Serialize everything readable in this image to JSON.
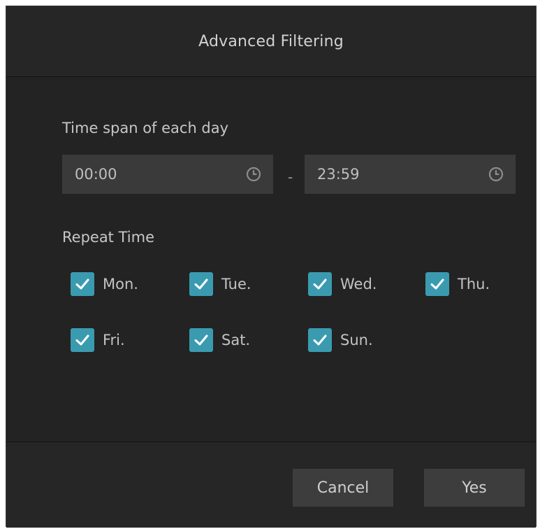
{
  "dialog": {
    "title": "Advanced Filtering"
  },
  "time_span": {
    "label": "Time span of each day",
    "start_value": "00:00",
    "separator": "-",
    "end_value": "23:59",
    "icon": "clock-icon"
  },
  "repeat": {
    "label": "Repeat Time",
    "days": [
      {
        "label": "Mon.",
        "checked": true
      },
      {
        "label": "Tue.",
        "checked": true
      },
      {
        "label": "Wed.",
        "checked": true
      },
      {
        "label": "Thu.",
        "checked": true
      },
      {
        "label": "Fri.",
        "checked": true
      },
      {
        "label": "Sat.",
        "checked": true
      },
      {
        "label": "Sun.",
        "checked": true
      }
    ]
  },
  "footer": {
    "cancel_label": "Cancel",
    "yes_label": "Yes"
  },
  "colors": {
    "dialog_bg": "#232323",
    "header_bg": "#262626",
    "field_bg": "#3a3a3a",
    "checkbox_accent": "#3a9bb0",
    "button_bg": "#3d3d3d"
  }
}
